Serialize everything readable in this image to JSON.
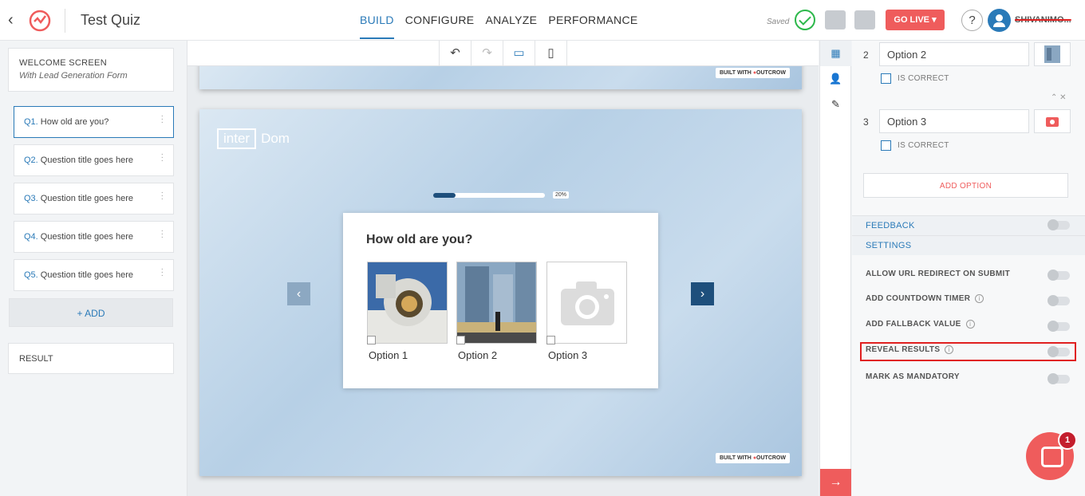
{
  "header": {
    "title": "Test Quiz",
    "tabs": [
      "BUILD",
      "CONFIGURE",
      "ANALYZE",
      "PERFORMANCE"
    ],
    "saved": "Saved",
    "go_live": "GO LIVE",
    "help": "?",
    "username": "SHIVANIMO..."
  },
  "left": {
    "welcome_title": "WELCOME SCREEN",
    "welcome_sub": "With Lead Generation Form",
    "questions": [
      {
        "num": "Q1.",
        "text": "How old are you?"
      },
      {
        "num": "Q2.",
        "text": "Question title goes here"
      },
      {
        "num": "Q3.",
        "text": "Question title goes here"
      },
      {
        "num": "Q4.",
        "text": "Question title goes here"
      },
      {
        "num": "Q5.",
        "text": "Question title goes here"
      }
    ],
    "add": "+ ADD",
    "result": "RESULT"
  },
  "canvas": {
    "built_with": "BUILT WITH",
    "built_brand": "OUTCROW",
    "brand_a": "inter",
    "brand_b": "Dom",
    "progress_pct": "20%",
    "progress_value": 0.2,
    "question": "How old are you?",
    "options": [
      "Option 1",
      "Option 2",
      "Option 3"
    ]
  },
  "right": {
    "opt2_num": "2",
    "opt2_value": "Option 2",
    "opt3_num": "3",
    "opt3_value": "Option 3",
    "is_correct": "IS CORRECT",
    "add_option": "ADD OPTION",
    "feedback": "FEEDBACK",
    "settings": "SETTINGS",
    "rows": [
      "ALLOW URL REDIRECT ON SUBMIT",
      "ADD COUNTDOWN TIMER",
      "ADD FALLBACK VALUE",
      "REVEAL RESULTS",
      "MARK AS MANDATORY"
    ]
  },
  "chat_badge": "1"
}
